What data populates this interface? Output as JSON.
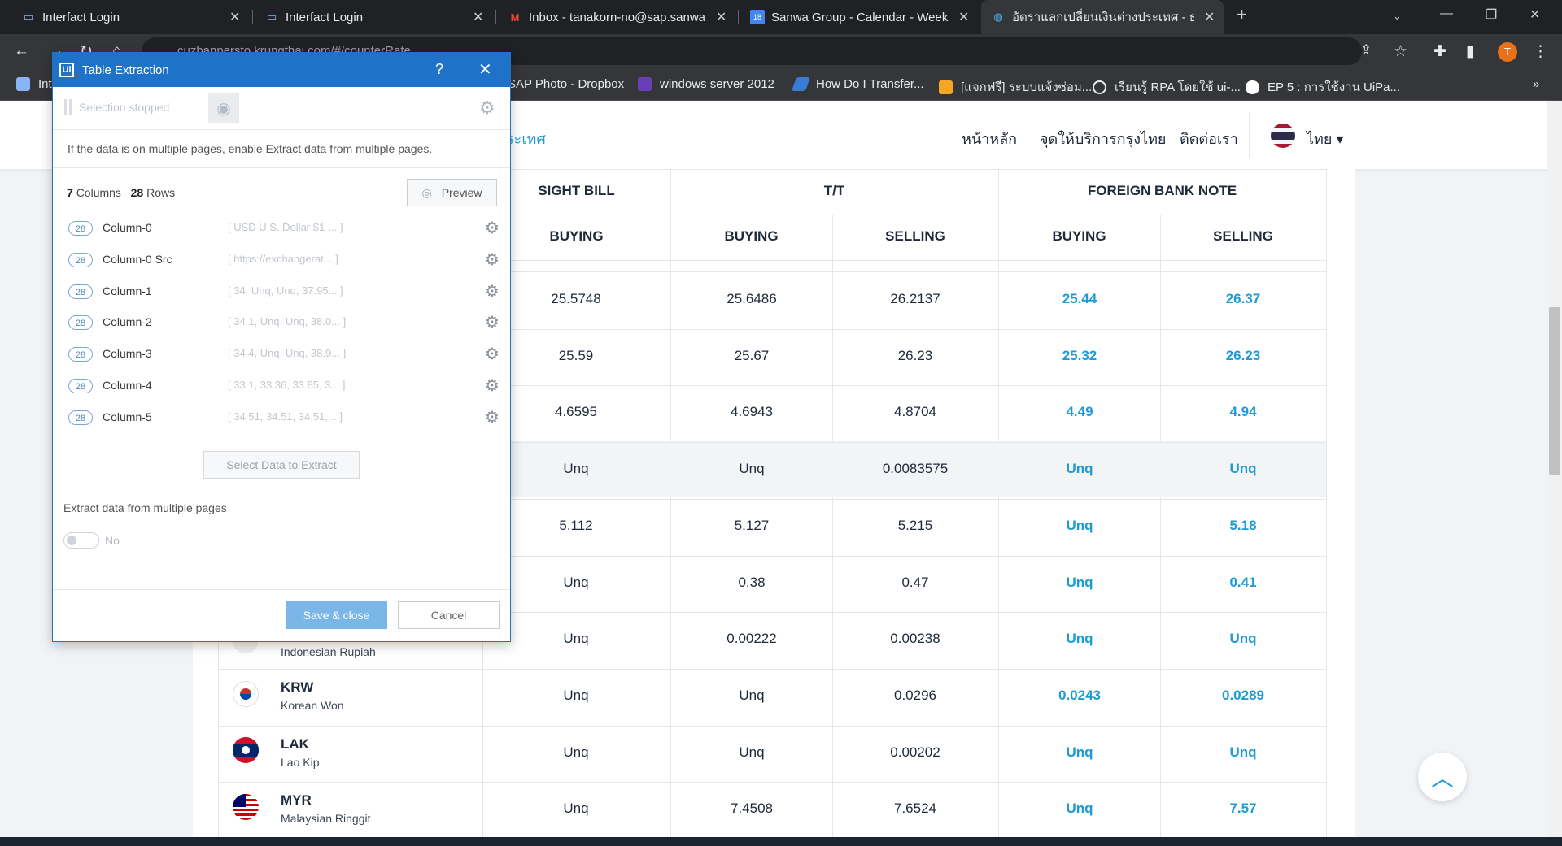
{
  "browser": {
    "tabs": [
      {
        "title": "Interfact Login",
        "icon": "monitor-icon"
      },
      {
        "title": "Interfact Login",
        "icon": "monitor-icon"
      },
      {
        "title": "Inbox - tanakorn-no@sap.sanwa",
        "icon": "gmail-icon"
      },
      {
        "title": "Sanwa Group - Calendar - Week",
        "icon": "calendar-icon"
      },
      {
        "title": "อัตราแลกเปลี่ยนเงินต่างประเทศ - ธนาค",
        "icon": "globe-icon"
      }
    ],
    "url": "cuzbanpersto.krungthai.com/#/counterRate",
    "profile_initial": "T",
    "bookmarks": [
      "Int",
      "SAP Photo - Dropbox",
      "windows server 2012",
      "How Do I Transfer...",
      "[แจกฟรี] ระบบแจ้งซ่อม...",
      "เรียนรู้ RPA โดยใช้ ui-...",
      "EP 5 : การใช้งาน UiPa..."
    ]
  },
  "site": {
    "title_fragment": "ระเทศ",
    "nav": [
      "หน้าหลัก",
      "จุดให้บริการกรุงไทย",
      "ติดต่อเรา"
    ],
    "lang": "ไทย ▾",
    "table": {
      "group_headers": [
        "SIGHT BILL",
        "T/T",
        "FOREIGN BANK NOTE"
      ],
      "sub_headers": [
        "BUYING",
        "BUYING",
        "SELLING",
        "BUYING",
        "SELLING"
      ],
      "rows": [
        {
          "code": "",
          "name": "",
          "values": [
            "25.5748",
            "25.6486",
            "26.2137",
            "25.44",
            "26.37"
          ]
        },
        {
          "code": "",
          "name": "",
          "values": [
            "25.59",
            "25.67",
            "26.23",
            "25.32",
            "26.23"
          ]
        },
        {
          "code": "",
          "name": "",
          "values": [
            "4.6595",
            "4.6943",
            "4.8704",
            "4.49",
            "4.94"
          ]
        },
        {
          "code": "",
          "name": "",
          "values": [
            "Unq",
            "Unq",
            "0.0083575",
            "Unq",
            "Unq"
          ]
        },
        {
          "code": "",
          "name": "",
          "values": [
            "5.112",
            "5.127",
            "5.215",
            "Unq",
            "5.18"
          ]
        },
        {
          "code": "",
          "name": "",
          "values": [
            "Unq",
            "0.38",
            "0.47",
            "Unq",
            "0.41"
          ]
        },
        {
          "code": "",
          "name": "Indonesian Rupiah",
          "values": [
            "Unq",
            "0.00222",
            "0.00238",
            "Unq",
            "Unq"
          ]
        },
        {
          "code": "KRW",
          "name": "Korean Won",
          "values": [
            "Unq",
            "Unq",
            "0.0296",
            "0.0243",
            "0.0289"
          ]
        },
        {
          "code": "LAK",
          "name": "Lao Kip",
          "values": [
            "Unq",
            "Unq",
            "0.00202",
            "Unq",
            "Unq"
          ]
        },
        {
          "code": "MYR",
          "name": "Malaysian Ringgit",
          "values": [
            "Unq",
            "7.4508",
            "7.6524",
            "Unq",
            "7.57"
          ]
        }
      ]
    }
  },
  "dialog": {
    "title": "Table Extraction",
    "help": "?",
    "selection_status": "Selection stopped",
    "info": "If the data is on multiple pages, enable Extract data from multiple pages.",
    "columns_count": "7",
    "columns_label": "Columns",
    "rows_count": "28",
    "rows_label": "Rows",
    "preview_label": "Preview",
    "columns": [
      {
        "count": "28",
        "name": "Column-0",
        "preview": "[ USD U.S. Dollar $1-...  ]"
      },
      {
        "count": "28",
        "name": "Column-0 Src",
        "preview": "[ https://exchangerat...  ]"
      },
      {
        "count": "28",
        "name": "Column-1",
        "preview": "[ 34, Unq, Unq, 37.95...  ]"
      },
      {
        "count": "28",
        "name": "Column-2",
        "preview": "[ 34.1, Unq, Unq, 38.0...  ]"
      },
      {
        "count": "28",
        "name": "Column-3",
        "preview": "[ 34.4, Unq, Unq, 38.9...  ]"
      },
      {
        "count": "28",
        "name": "Column-4",
        "preview": "[ 33.1, 33.36, 33.85, 3...  ]"
      },
      {
        "count": "28",
        "name": "Column-5",
        "preview": "[ 34.51, 34.51, 34.51,...  ]"
      }
    ],
    "select_data_label": "Select Data to Extract",
    "multi_pages_label": "Extract data from multiple pages",
    "toggle_value": "No",
    "save_label": "Save & close",
    "cancel_label": "Cancel"
  }
}
